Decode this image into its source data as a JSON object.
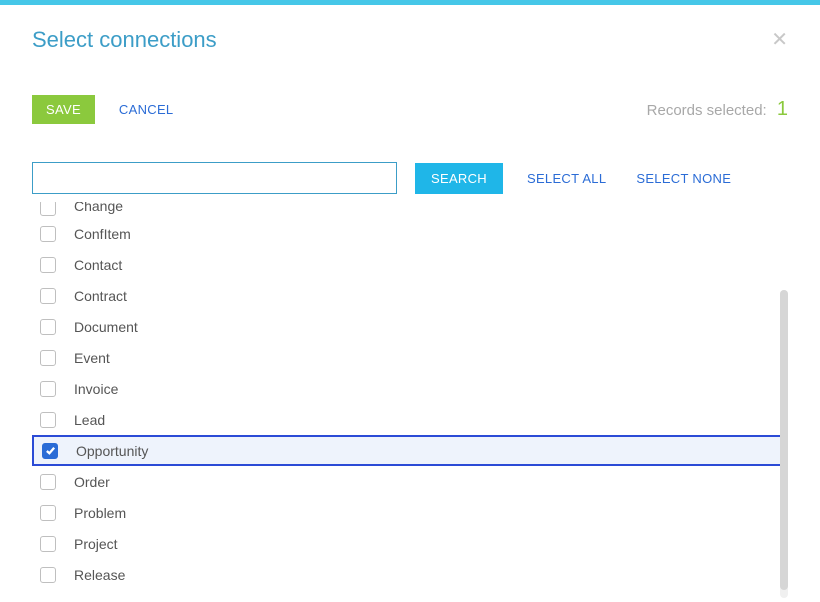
{
  "header": {
    "title": "Select connections"
  },
  "actions": {
    "save": "SAVE",
    "cancel": "CANCEL",
    "records_label": "Records selected:",
    "records_count": "1"
  },
  "search": {
    "value": "",
    "button": "SEARCH",
    "select_all": "SELECT ALL",
    "select_none": "SELECT NONE"
  },
  "items": [
    {
      "label": "Change",
      "checked": false,
      "cut": true
    },
    {
      "label": "ConfItem",
      "checked": false
    },
    {
      "label": "Contact",
      "checked": false
    },
    {
      "label": "Contract",
      "checked": false
    },
    {
      "label": "Document",
      "checked": false
    },
    {
      "label": "Event",
      "checked": false
    },
    {
      "label": "Invoice",
      "checked": false
    },
    {
      "label": "Lead",
      "checked": false
    },
    {
      "label": "Opportunity",
      "checked": true
    },
    {
      "label": "Order",
      "checked": false
    },
    {
      "label": "Problem",
      "checked": false
    },
    {
      "label": "Project",
      "checked": false
    },
    {
      "label": "Release",
      "checked": false
    }
  ]
}
